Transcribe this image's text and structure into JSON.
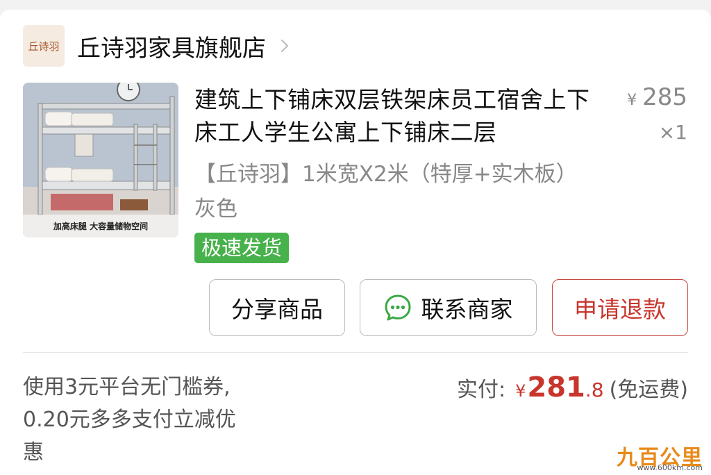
{
  "store": {
    "logo_text": "丘诗羽",
    "name": "丘诗羽家具旗舰店",
    "chevron_icon": "chevron-right-icon"
  },
  "product": {
    "thumb_caption": "加高床腿  大容量储物空间",
    "title": "建筑上下铺床双层铁架床员工宿舍上下床工人学生公寓上下铺床二层",
    "spec": "【丘诗羽】1米宽X2米（特厚+实木板）灰色",
    "price_symbol": "¥",
    "price": "285",
    "qty": "×1",
    "tag": "极速发货"
  },
  "actions": {
    "share": "分享商品",
    "contact": "联系商家",
    "refund": "申请退款"
  },
  "summary": {
    "promo": "使用3元平台无门槛券, 0.20元多多支付立减优惠",
    "paid_label": "实付:",
    "currency": "¥",
    "amount_int": "281",
    "amount_dec": ".8",
    "shipping": "(免运费)"
  },
  "watermark": {
    "main": "九百公里",
    "url": "www.600km.com"
  },
  "colors": {
    "accent_red": "#c8352c",
    "tag_green": "#47b14b",
    "chat_green": "#3aa845"
  }
}
